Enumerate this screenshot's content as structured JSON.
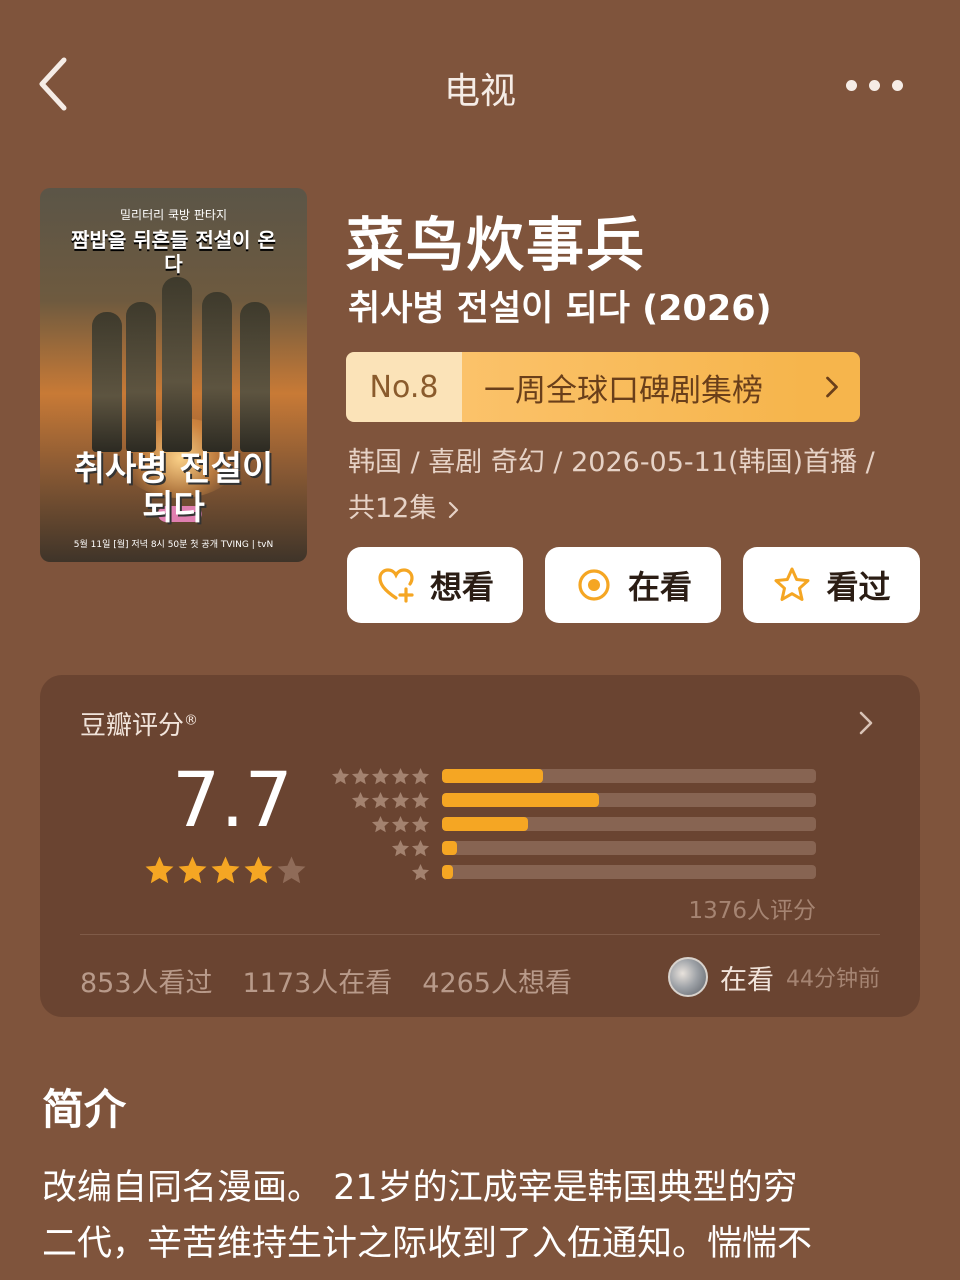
{
  "nav": {
    "title": "电视",
    "back_icon": "chevron-left-icon",
    "more_icon": "more-dots-icon"
  },
  "poster": {
    "top_text": "밀리터리 쿡방 판타지",
    "headline": "짬밥을 뒤흔들 전설이 온다",
    "logo": "취사병 전설이되다",
    "footer": "5월 11일 [월] 저녁 8시 50분 첫 공개 TVING | tvN"
  },
  "show": {
    "title": "菜鸟炊事兵",
    "original_title": "취사병 전설이 되다 (2026)"
  },
  "rank": {
    "number": "No.8",
    "list_name": "一周全球口碑剧集榜"
  },
  "meta": {
    "line1": "韩国 / 喜剧 奇幻 / 2026-05-11(韩国)首播 /",
    "line2": "共12集"
  },
  "actions": {
    "want": "想看",
    "watching": "在看",
    "watched": "看过"
  },
  "rating": {
    "label": "豆瓣评分",
    "reg_mark": "®",
    "score": "7.7",
    "stars": 4,
    "distribution": [
      {
        "stars": 5,
        "fraction": 0.27
      },
      {
        "stars": 4,
        "fraction": 0.42
      },
      {
        "stars": 3,
        "fraction": 0.23
      },
      {
        "stars": 2,
        "fraction": 0.04
      },
      {
        "stars": 1,
        "fraction": 0.03
      }
    ],
    "count": "1376人评分",
    "watched_count": "853人看过",
    "watching_count": "1173人在看",
    "want_count": "4265人想看",
    "recent_status": "在看",
    "recent_time": "44分钟前"
  },
  "intro": {
    "title": "简介",
    "line1": "改编自同名漫画。 21岁的江成宰是韩国典型的穷",
    "line2": "二代，辛苦维持生计之际收到了入伍通知。惴惴不"
  },
  "colors": {
    "background": "#7f543c",
    "card": "#6a4431",
    "accent": "#f5a623",
    "rank_bg": "#f6b54c"
  }
}
